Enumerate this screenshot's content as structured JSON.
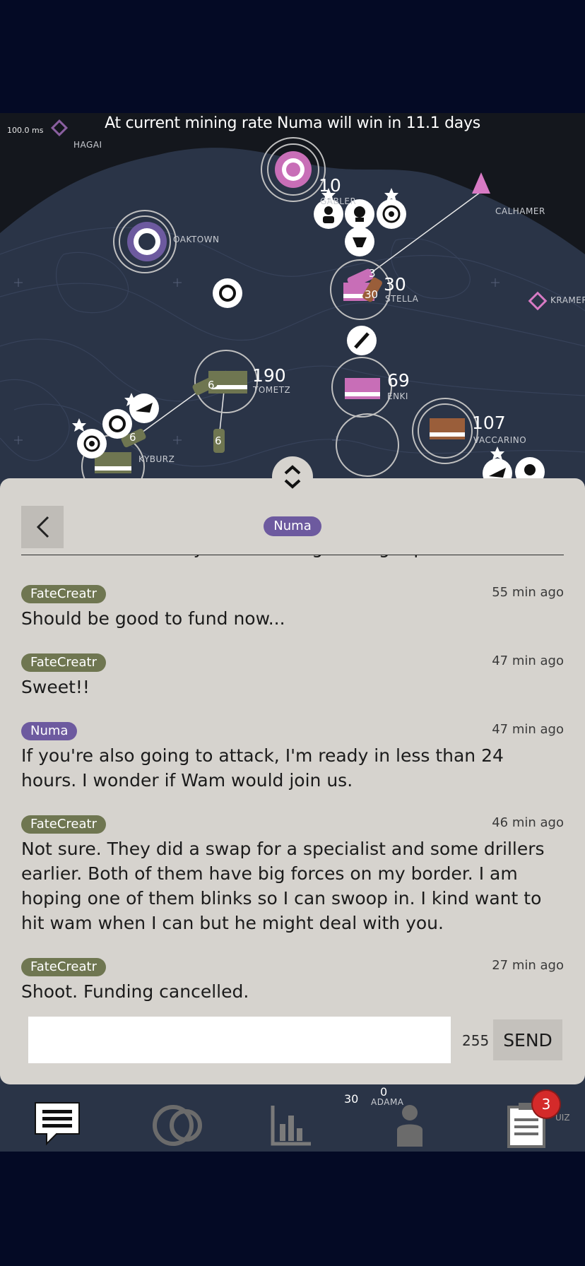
{
  "hud": {
    "ping": "100.0 ms",
    "banner": "At current mining rate Numa will win in 11.1 days"
  },
  "map": {
    "places": [
      "HAGAI",
      "GABLER",
      "CALHAMER",
      "OAKTOWN",
      "STELLA",
      "KRAMER",
      "TOMETZ",
      "ENKI",
      "VACCARINO",
      "KYBURZ",
      "ADAMA"
    ],
    "numbers": {
      "gabler": "10",
      "stella": "30",
      "tometz": "190",
      "enki": "69",
      "vaccarino": "107",
      "unit_3": "3",
      "unit_30": "30",
      "unit_6a": "6",
      "unit_6b": "6",
      "unit_6c": "6",
      "bottom_30": "30",
      "bottom_0": "0"
    },
    "colors": {
      "numa": "#c86eb7",
      "fatecreatr": "#6f7651",
      "vaccarino": "#9a5e3a",
      "calhamer": "#d77ac4",
      "ocean": "#2a3447",
      "void": "#14171d"
    }
  },
  "chat": {
    "channel": "Numa",
    "partial_message": "Let me know when you are hitting manager please.",
    "messages": [
      {
        "sender": "FateCreatr",
        "time": "55 min ago",
        "text": "Should be good to fund now..."
      },
      {
        "sender": "FateCreatr",
        "time": "47 min ago",
        "text": "Sweet!!"
      },
      {
        "sender": "Numa",
        "time": "47 min ago",
        "text": "If you're also going to attack, I'm ready in less than 24 hours. I wonder if Wam would join us."
      },
      {
        "sender": "FateCreatr",
        "time": "46 min ago",
        "text": "Not sure.  They did a swap for a specialist and some drillers earlier.  Both of them have big forces on my border.  I am hoping one of them blinks so I can swoop in.  I kind want to hit wam when I can but he might deal with you."
      },
      {
        "sender": "FateCreatr",
        "time": "27 min ago",
        "text": "Shoot. Funding cancelled."
      }
    ],
    "input_value": "",
    "char_count": "255",
    "send_label": "SEND"
  },
  "tabs": {
    "items": [
      "chat-icon",
      "empire-icon",
      "stats-icon",
      "leaderboard-icon",
      "reports-icon"
    ],
    "reports_badge": "3",
    "reports_label": "UIZ"
  }
}
